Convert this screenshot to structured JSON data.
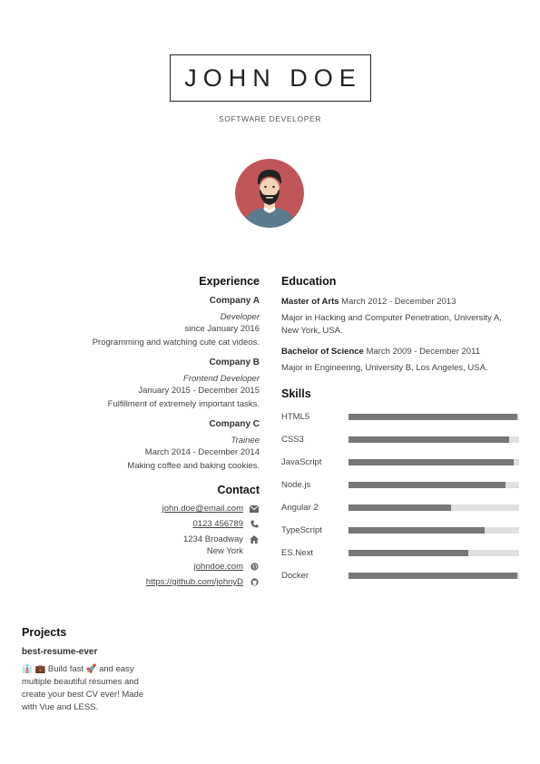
{
  "header": {
    "name": "JOHN DOE",
    "position": "SOFTWARE DEVELOPER"
  },
  "colors": {
    "avatar_bg": "#c0565a",
    "shirt": "#5b7a8c",
    "bar_fill": "#777777",
    "bar_track": "#e0e0e0"
  },
  "experience": {
    "title": "Experience",
    "items": [
      {
        "company": "Company A",
        "position": "Developer",
        "timeperiod": "since January 2016",
        "description": "Programming and watching cute cat videos."
      },
      {
        "company": "Company B",
        "position": "Frontend Developer",
        "timeperiod": "January 2015 - December 2015",
        "description": "Fulfillment of extremely important tasks."
      },
      {
        "company": "Company C",
        "position": "Trainee",
        "timeperiod": "March 2014 - December 2014",
        "description": "Making coffee and baking cookies."
      }
    ]
  },
  "contact": {
    "title": "Contact",
    "email": "john.doe@email.com",
    "phone": "0123 456789",
    "street": "1234 Broadway",
    "city": "New York",
    "website": "johndoe.com",
    "github": "https://github.com/johnyD",
    "icons": [
      "envelope-icon",
      "phone-icon",
      "home-icon",
      "globe-icon",
      "github-icon"
    ]
  },
  "education": {
    "title": "Education",
    "items": [
      {
        "degree": "Master of Arts",
        "timeperiod": "March 2012 - December 2013",
        "description": "Major in Hacking and Computer Penetration, University A, New York, USA."
      },
      {
        "degree": "Bachelor of Science",
        "timeperiod": "March 2009 - December 2011",
        "description": "Major in Engineering, University B, Los Angeles, USA."
      }
    ]
  },
  "skills": {
    "title": "Skills",
    "items": [
      {
        "name": "HTML5",
        "level": 99
      },
      {
        "name": "CSS3",
        "level": 94
      },
      {
        "name": "JavaScript",
        "level": 97
      },
      {
        "name": "Node.js",
        "level": 92
      },
      {
        "name": "Angular 2",
        "level": 60
      },
      {
        "name": "TypeScript",
        "level": 80
      },
      {
        "name": "ES.Next",
        "level": 70
      },
      {
        "name": "Docker",
        "level": 99
      }
    ]
  },
  "projects": {
    "title": "Projects",
    "items": [
      {
        "name": "best-resume-ever",
        "description": "👔 💼 Build fast 🚀 and easy multiple beautiful resumes and create your best CV ever! Made with Vue and LESS."
      }
    ]
  }
}
